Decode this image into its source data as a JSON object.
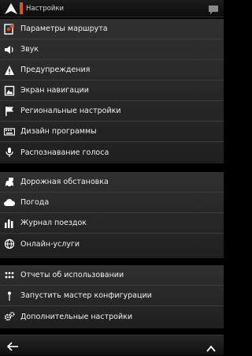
{
  "header": {
    "title": "Настройки",
    "accent_color": "#e24e14"
  },
  "groups": [
    {
      "items": [
        {
          "label": "Параметры маршрута",
          "icon": "route-options-icon"
        },
        {
          "label": "Звук",
          "icon": "speaker-icon"
        },
        {
          "label": "Предупреждения",
          "icon": "warning-icon"
        },
        {
          "label": "Экран навигации",
          "icon": "map-screen-icon"
        },
        {
          "label": "Региональные настройки",
          "icon": "flag-icon"
        },
        {
          "label": "Дизайн программы",
          "icon": "keyboard-icon"
        },
        {
          "label": "Распознавание голоса",
          "icon": "microphone-icon"
        }
      ]
    },
    {
      "items": [
        {
          "label": "Дорожная обстановка",
          "icon": "traffic-car-icon"
        },
        {
          "label": "Погода",
          "icon": "cloud-icon"
        },
        {
          "label": "Журнал поездок",
          "icon": "bar-chart-icon"
        },
        {
          "label": "Онлайн-услуги",
          "icon": "globe-icon"
        }
      ]
    },
    {
      "items": [
        {
          "label": "Отчеты об использовании",
          "icon": "dots-grid-icon"
        },
        {
          "label": "Запустить мастер конфигурации",
          "icon": "pin-icon"
        },
        {
          "label": "Дополнительные настройки",
          "icon": "gears-icon"
        }
      ]
    }
  ],
  "footer": {
    "back_icon": "back-arrow-icon",
    "up_icon": "chevron-up-icon"
  }
}
